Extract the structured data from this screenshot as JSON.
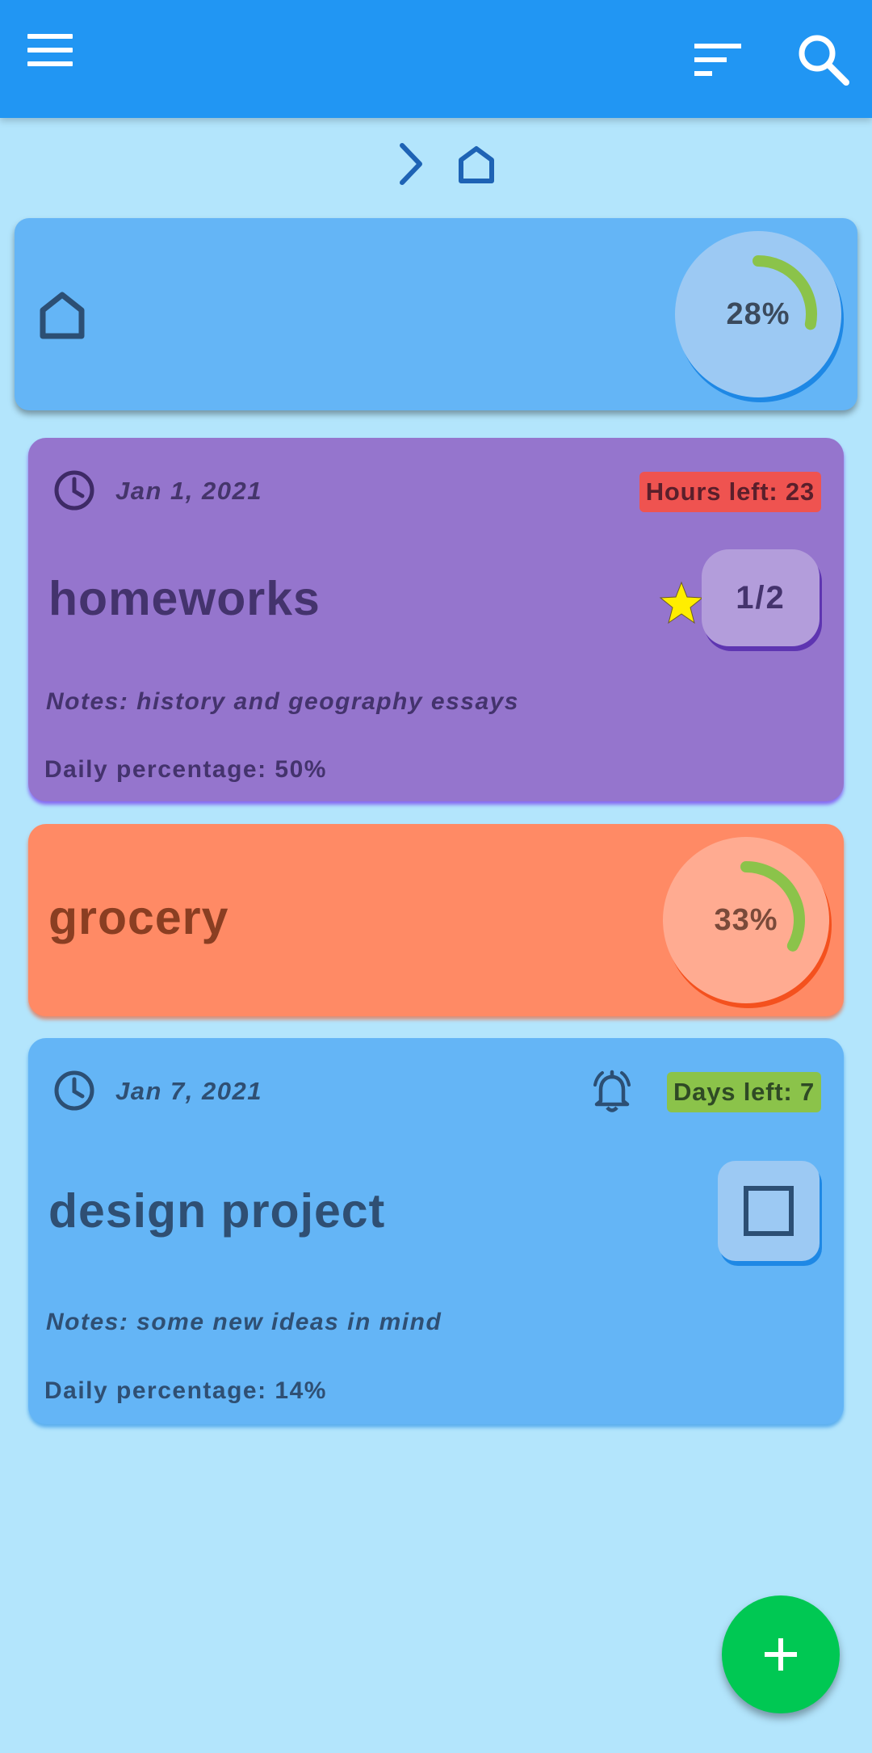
{
  "colors": {
    "appbar": "#2196f3",
    "background": "#b3e5fc",
    "fab": "#00c853",
    "progress_arc": "#8bc34a"
  },
  "appbar": {
    "menu_icon": "menu-icon",
    "filter_icon": "sort-icon",
    "search_icon": "search-icon"
  },
  "breadcrumb": {
    "separator_icon": "chevron-right-icon",
    "home_icon": "home-icon"
  },
  "root_card": {
    "icon": "home-icon",
    "progress_label": "28%",
    "progress": 0.28,
    "color": "#64b5f6"
  },
  "tasks": [
    {
      "date": "Jan 1, 2021",
      "badge": "Hours left: 23",
      "title": "homeworks",
      "counter": "1/2",
      "starred": true,
      "notes": "Notes: history and geography essays",
      "daily": "Daily percentage: 50%",
      "color": "#9575cd"
    },
    {
      "title": "grocery",
      "progress_label": "33%",
      "progress": 0.33,
      "color": "#ff8a65"
    },
    {
      "date": "Jan 7, 2021",
      "badge": "Days left: 7",
      "alarm_icon": "alarm-bell-icon",
      "title": "design project",
      "checked": false,
      "notes": "Notes: some new ideas in mind",
      "daily": "Daily percentage: 14%",
      "color": "#64b5f6"
    }
  ],
  "fab": {
    "icon": "plus-icon"
  }
}
